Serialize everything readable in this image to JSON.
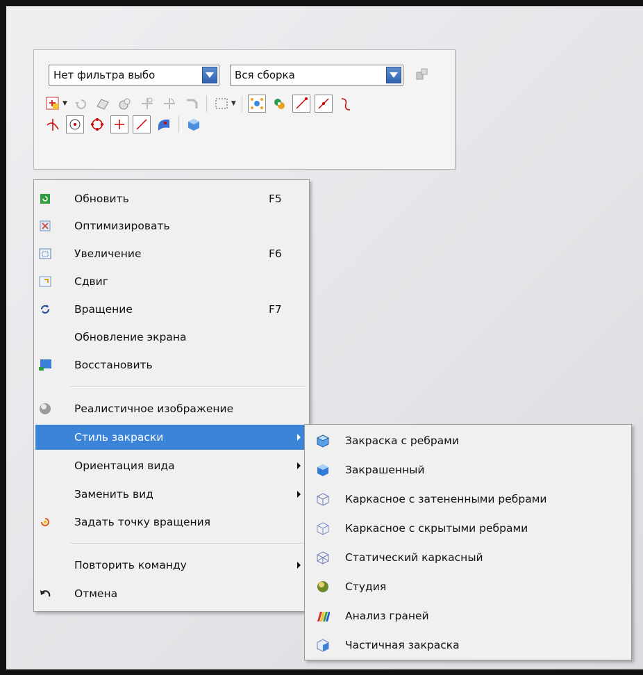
{
  "toolbar": {
    "filter_value": "Нет фильтра выбо",
    "scope_value": "Вся сборка"
  },
  "menu": {
    "items": [
      {
        "label": "Обновить",
        "shortcut": "F5",
        "icon": "refresh-icon"
      },
      {
        "label": "Оптимизировать",
        "shortcut": "",
        "icon": "fit-icon"
      },
      {
        "label": "Увеличение",
        "shortcut": "F6",
        "icon": "zoom-icon"
      },
      {
        "label": "Сдвиг",
        "shortcut": "",
        "icon": "pan-icon"
      },
      {
        "label": "Вращение",
        "shortcut": "F7",
        "icon": "rotate-icon"
      },
      {
        "label": "Обновление экрана",
        "shortcut": "",
        "icon": ""
      },
      {
        "label": "Восстановить",
        "shortcut": "",
        "icon": "restore-icon"
      },
      {
        "label": "Реалистичное изображение",
        "shortcut": "",
        "icon": "sphere-icon"
      },
      {
        "label": "Стиль закраски",
        "shortcut": "",
        "icon": "",
        "submenu": true
      },
      {
        "label": "Ориентация вида",
        "shortcut": "",
        "icon": "",
        "submenu": true
      },
      {
        "label": "Заменить вид",
        "shortcut": "",
        "icon": "",
        "submenu": true
      },
      {
        "label": "Задать точку вращения",
        "shortcut": "",
        "icon": "rotation-point-icon"
      },
      {
        "label": "Повторить команду",
        "shortcut": "",
        "icon": "",
        "submenu": true
      },
      {
        "label": "Отмена",
        "shortcut": "",
        "icon": "undo-icon"
      }
    ]
  },
  "submenu": {
    "items": [
      {
        "label": "Закраска с ребрами",
        "icon": "shaded-edges-icon"
      },
      {
        "label": "Закрашенный",
        "icon": "shaded-icon"
      },
      {
        "label": "Каркасное с затененными ребрами",
        "icon": "wireframe-dim-icon"
      },
      {
        "label": "Каркасное с скрытыми ребрами",
        "icon": "wireframe-hidden-icon"
      },
      {
        "label": "Статический каркасный",
        "icon": "static-wireframe-icon"
      },
      {
        "label": "Студия",
        "icon": "studio-icon"
      },
      {
        "label": "Анализ граней",
        "icon": "face-analysis-icon"
      },
      {
        "label": "Частичная закраска",
        "icon": "partial-shading-icon"
      }
    ]
  },
  "colors": {
    "highlight": "#3b84d8",
    "menu_bg": "#f0f0f0",
    "combo_arrow": "#2f62b0"
  }
}
